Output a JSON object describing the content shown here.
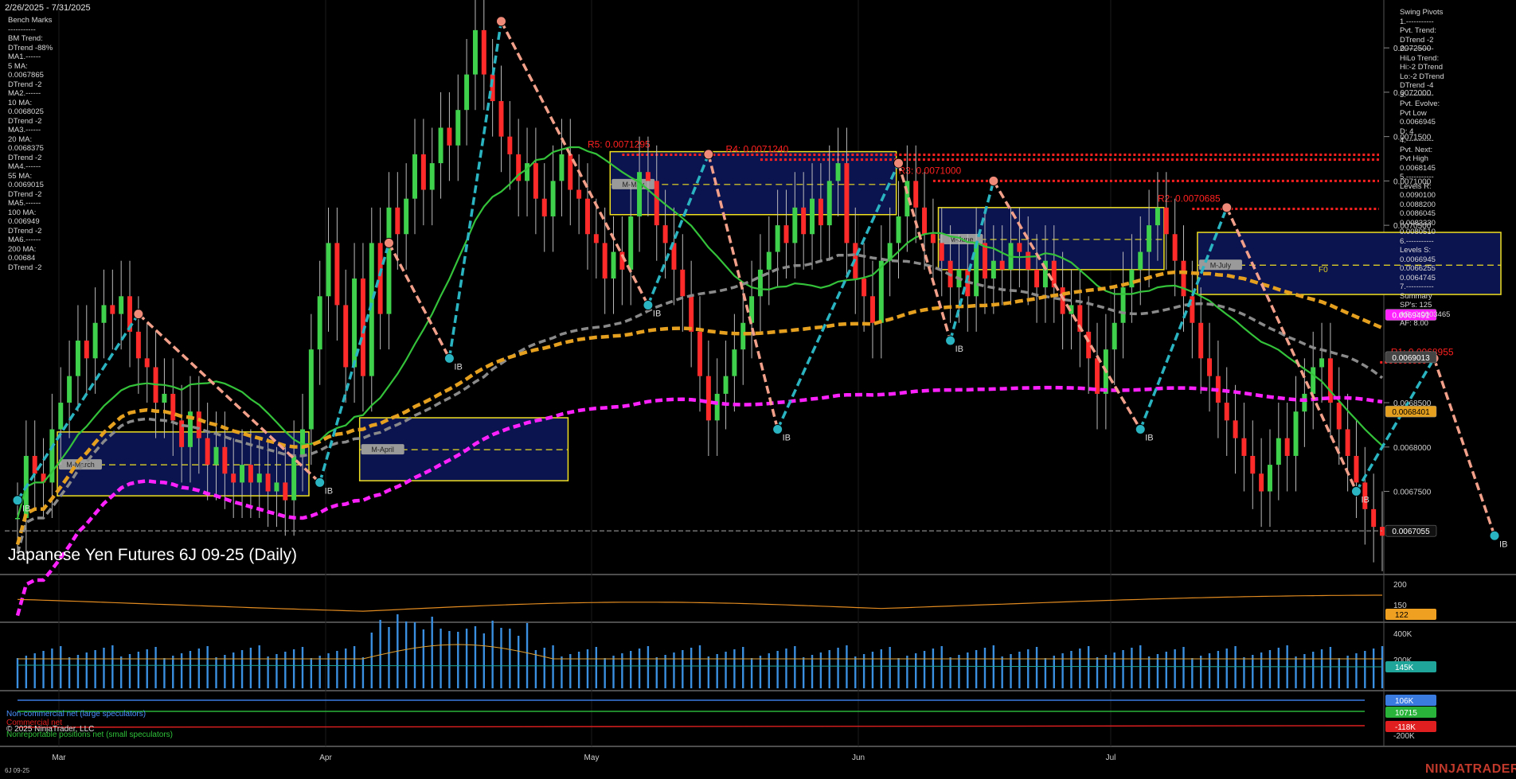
{
  "header": {
    "date_range": "2/26/2025 - 7/31/2025"
  },
  "left_panel": {
    "lines": [
      "Bench Marks",
      "-----------",
      "BM Trend:",
      "DTrend -88%",
      "MA1.------",
      "5 MA:",
      "0.0067865",
      "DTrend -2",
      "MA2.------",
      "10 MA:",
      "0.0068025",
      "DTrend -2",
      "MA3.------",
      "20 MA:",
      "0.0068375",
      "DTrend -2",
      "MA4.------",
      "55 MA:",
      "0.0069015",
      "DTrend -2",
      "MA5.------",
      "100 MA:",
      "0.006949",
      "DTrend -2",
      "MA6.------",
      "200 MA:",
      "0.00684",
      "DTrend -2"
    ]
  },
  "right_panel": {
    "lines": [
      "Swing Pivots",
      "1.-----------",
      "Pvt. Trend:",
      "DTrend -2",
      "2.-----------",
      "HiLo Trend:",
      "Hi:-2 DTrend",
      "Lo:-2 DTrend",
      "DTrend -4",
      "3.-----------",
      "Pvt. Evolve:",
      "Pvt Low",
      "0.0066945",
      "D: 4",
      "4.-----------",
      "Pvt. Next:",
      "Pvt High",
      "0.0068145",
      "5.-----------",
      "Levels R:",
      "0.0090100",
      "0.0088200",
      "0.0086045",
      "0.0083330",
      "0.0080510",
      "6.-----------",
      "Levels S:",
      "0.0066945",
      "0.0066255",
      "0.0064745",
      "7.-----------",
      "Summary",
      "SP's: 125",
      "AR: 0.0003465",
      "AF: 8.00"
    ]
  },
  "title": "Japanese Yen Futures 6J 09-25 (Daily)",
  "legend": {
    "noncommercial": "Non-commercial net (large speculators)",
    "commercial": "Commercial net",
    "nonreportable": "Nonreportable positions net (small speculators)"
  },
  "copyright": "© 2025 NinjaTrader, LLC",
  "footer_symbol": "6J 09-25",
  "brand": "NINJATRADER",
  "colors": {
    "background": "#000000",
    "up_candle": "#3fd14b",
    "down_candle": "#ff2a2a",
    "ma_green": "#34c23a",
    "ma_gray": "#8a8a8a",
    "ma_orange": "#e5a020",
    "ma_magenta": "#ff22ff",
    "swing_up": "#2ab3c0",
    "swing_down": "#f2a08a",
    "resistance": "#ff2020",
    "box_fill": "#0c1450",
    "box_border": "#f0e020"
  },
  "chart_data": {
    "type": "candlestick",
    "title": "Japanese Yen Futures 6J 09-25 (Daily)",
    "x_ticks": [
      "Mar",
      "Apr",
      "May",
      "Jun",
      "Jul"
    ],
    "y_ticks": [
      0.00725,
      0.0072,
      0.00715,
      0.0071,
      0.00705,
      0.007,
      0.00685,
      0.0068,
      0.00675
    ],
    "ylim": [
      0.006685,
      0.007295
    ],
    "y_tick_labels": [
      "0.0072500",
      "0.0072000",
      "0.0071500",
      "0.0071000",
      "0.0070500",
      "0.0070000",
      "0.0068500",
      "0.0068000",
      "0.0067500"
    ],
    "price_tags": [
      {
        "value": 0.0069491,
        "label": "0.0069491",
        "color": "#ff22ff",
        "text": "#ffffff"
      },
      {
        "value": 0.0069013,
        "label": "0.0069013",
        "color": "#444444",
        "text": "#ffffff"
      },
      {
        "value": 0.0068401,
        "label": "0.0068401",
        "color": "#e5a020",
        "text": "#000000"
      },
      {
        "value": 0.0067055,
        "label": "0.0067055",
        "color": "#111111",
        "text": "#ffffff"
      }
    ],
    "closes": [
      0.00672,
      0.00679,
      0.00677,
      0.00676,
      0.00682,
      0.00685,
      0.00688,
      0.00692,
      0.0069,
      0.00694,
      0.00696,
      0.00695,
      0.00697,
      0.00693,
      0.0069,
      0.00689,
      0.00685,
      0.00686,
      0.00683,
      0.0068,
      0.00684,
      0.00681,
      0.00678,
      0.0068,
      0.00677,
      0.00676,
      0.00678,
      0.00676,
      0.00677,
      0.00675,
      0.00676,
      0.00674,
      0.00679,
      0.00682,
      0.00691,
      0.00697,
      0.00703,
      0.00696,
      0.00689,
      0.00699,
      0.00688,
      0.00703,
      0.00695,
      0.00707,
      0.00704,
      0.00708,
      0.00713,
      0.00709,
      0.00712,
      0.00716,
      0.00714,
      0.00718,
      0.00722,
      0.00727,
      0.00722,
      0.00719,
      0.00715,
      0.00713,
      0.0071,
      0.00712,
      0.00708,
      0.00706,
      0.0071,
      0.00713,
      0.00709,
      0.00708,
      0.00704,
      0.00703,
      0.00699,
      0.00702,
      0.007,
      0.00706,
      0.00711,
      0.0071,
      0.00705,
      0.00703,
      0.007,
      0.00697,
      0.00693,
      0.00688,
      0.00683,
      0.00686,
      0.00688,
      0.00691,
      0.00694,
      0.00697,
      0.007,
      0.00702,
      0.00705,
      0.00703,
      0.00707,
      0.00704,
      0.00708,
      0.00705,
      0.0071,
      0.00712,
      0.00703,
      0.00699,
      0.00697,
      0.00694,
      0.00701,
      0.00703,
      0.00706,
      0.0071,
      0.00707,
      0.00704,
      0.00703,
      0.00701,
      0.00698,
      0.007,
      0.00697,
      0.00703,
      0.00699,
      0.00701,
      0.007,
      0.00703,
      0.00702,
      0.007,
      0.00698,
      0.00701,
      0.00698,
      0.00695,
      0.00696,
      0.00693,
      0.0069,
      0.00686,
      0.00691,
      0.00694,
      0.00698,
      0.007,
      0.00702,
      0.00705,
      0.00707,
      0.00704,
      0.00701,
      0.00697,
      0.00694,
      0.0069,
      0.00688,
      0.00685,
      0.00683,
      0.00681,
      0.00679,
      0.00677,
      0.00675,
      0.00678,
      0.00681,
      0.00679,
      0.00684,
      0.00686,
      0.00689,
      0.0069,
      0.00685,
      0.00682,
      0.00679,
      0.00676,
      0.00673,
      0.00671,
      0.0067
    ],
    "swing_points": [
      {
        "i": 0,
        "v": 0.00674,
        "t": "L"
      },
      {
        "i": 14,
        "v": 0.00695,
        "t": "H"
      },
      {
        "i": 35,
        "v": 0.00676,
        "t": "L"
      },
      {
        "i": 43,
        "v": 0.00703,
        "t": "H"
      },
      {
        "i": 50,
        "v": 0.0069,
        "t": "L"
      },
      {
        "i": 56,
        "v": 0.00728,
        "t": "H"
      },
      {
        "i": 73,
        "v": 0.00696,
        "t": "L"
      },
      {
        "i": 80,
        "v": 0.00713,
        "t": "H"
      },
      {
        "i": 88,
        "v": 0.00682,
        "t": "L"
      },
      {
        "i": 102,
        "v": 0.00712,
        "t": "H"
      },
      {
        "i": 108,
        "v": 0.00692,
        "t": "L"
      },
      {
        "i": 113,
        "v": 0.0071,
        "t": "H"
      },
      {
        "i": 130,
        "v": 0.00682,
        "t": "L"
      },
      {
        "i": 140,
        "v": 0.00707,
        "t": "H"
      },
      {
        "i": 155,
        "v": 0.00675,
        "t": "L"
      },
      {
        "i": 164,
        "v": 0.0069,
        "t": "H"
      },
      {
        "i": 171,
        "v": 0.0067,
        "t": "L"
      }
    ],
    "resistance_levels": [
      {
        "label": "R5: 0.0071295",
        "value": 0.0071295
      },
      {
        "label": "R4: 0.0071240",
        "value": 0.007124
      },
      {
        "label": "R3: 0.0071000",
        "value": 0.0071
      },
      {
        "label": "R2: 0.0070685",
        "value": 0.0070685
      },
      {
        "label": "R1: 0.0068955",
        "value": 0.0068955
      }
    ],
    "monthly_boxes": [
      {
        "label": "M-March",
        "hi": 0.006817,
        "lo": 0.006745,
        "mid": 0.00678
      },
      {
        "label": "M-April",
        "hi": 0.006833,
        "lo": 0.006762,
        "mid": 0.006797
      },
      {
        "label": "M-May",
        "hi": 0.007133,
        "lo": 0.007062,
        "mid": 0.007096
      },
      {
        "label": "M-June",
        "hi": 0.00707,
        "lo": 0.007,
        "mid": 0.007034
      },
      {
        "label": "M-July",
        "hi": 0.007042,
        "lo": 0.006972,
        "mid": 0.007005
      }
    ],
    "swing_labels": [
      "IB"
    ],
    "fib_label": "F0",
    "indicator_panels": [
      {
        "name": "momentum",
        "ticks": [
          "200",
          "150"
        ],
        "tags": [
          {
            "label": "122",
            "color": "#f0a020",
            "text": "#000000"
          }
        ]
      },
      {
        "name": "volume",
        "ticks": [
          "400K",
          "200K"
        ],
        "tags": [
          {
            "label": "145K",
            "color": "#1fa59a",
            "text": "#ffffff"
          }
        ]
      },
      {
        "name": "cot",
        "ticks": [
          "-200K"
        ],
        "tags": [
          {
            "label": "106K",
            "color": "#3a7be0",
            "text": "#ffffff"
          },
          {
            "label": "10715",
            "color": "#2ab33a",
            "text": "#ffffff"
          },
          {
            "label": "-118K",
            "color": "#e02020",
            "text": "#ffffff"
          }
        ]
      }
    ]
  }
}
